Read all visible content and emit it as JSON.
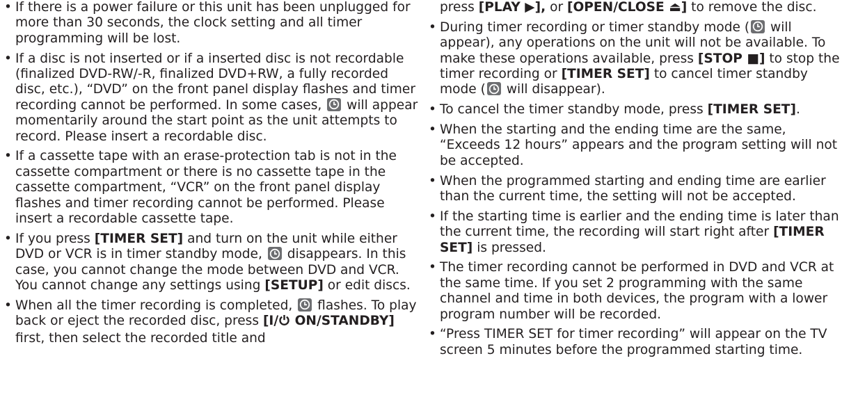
{
  "left_column": [
    {
      "parts": [
        {
          "t": "If there is a power failure or this unit has been unplugged for more than 30 seconds, the clock setting and all timer programming will be lost."
        }
      ]
    },
    {
      "parts": [
        {
          "t": "If a disc is not inserted or if a inserted disc is not recordable (finalized DVD-RW/-R, finalized DVD+RW, a fully recorded disc, etc.), “DVD” on the front panel display flashes and timer recording cannot be performed. In some cases, "
        },
        {
          "icon": "timer-icon"
        },
        {
          "t": " will appear momentarily around the start point as the unit attempts to record. Please insert a recordable disc."
        }
      ]
    },
    {
      "parts": [
        {
          "t": "If a cassette tape with an erase-protection tab is not in the cassette compartment or there is no cassette tape in the cassette compartment, “VCR” on the front panel display flashes and timer recording cannot be performed. Please insert a recordable cassette tape."
        }
      ]
    },
    {
      "parts": [
        {
          "t": "If you press "
        },
        {
          "b": "[TIMER SET]"
        },
        {
          "t": " and turn on the unit while either DVD or VCR is in timer standby mode, "
        },
        {
          "icon": "timer-icon"
        },
        {
          "t": " disappears. In this case, you cannot change the mode between DVD and VCR. You cannot change any settings using "
        },
        {
          "b": "[SETUP]"
        },
        {
          "t": " or edit discs."
        }
      ]
    },
    {
      "parts": [
        {
          "t": "When all the timer recording is completed, "
        },
        {
          "icon": "timer-icon"
        },
        {
          "t": " flashes. To play back or eject the recorded disc, press "
        },
        {
          "b": "[I/"
        },
        {
          "icon": "power-icon"
        },
        {
          "b": " ON/STANDBY]"
        },
        {
          "t": " first, then select the recorded title and"
        }
      ]
    }
  ],
  "right_column_continuation": [
    {
      "t": "press "
    },
    {
      "b": "[PLAY ▶],"
    },
    {
      "t": " or "
    },
    {
      "b": "[OPEN/CLOSE ⏏]"
    },
    {
      "t": " to remove the disc."
    }
  ],
  "right_column": [
    {
      "parts": [
        {
          "t": "During timer recording or timer standby mode ("
        },
        {
          "icon": "timer-icon"
        },
        {
          "t": " will appear), any operations on the unit will not be available. To make these operations available, press "
        },
        {
          "b": "[STOP ■]"
        },
        {
          "t": " to stop the timer recording or "
        },
        {
          "b": "[TIMER SET]"
        },
        {
          "t": " to cancel timer standby mode ("
        },
        {
          "icon": "timer-icon"
        },
        {
          "t": " will disappear)."
        }
      ]
    },
    {
      "parts": [
        {
          "t": "To cancel the timer standby mode, press "
        },
        {
          "b": "[TIMER SET]"
        },
        {
          "t": "."
        }
      ]
    },
    {
      "parts": [
        {
          "t": "When the starting and the ending time are the same, “Exceeds 12 hours” appears and the program setting will not be accepted."
        }
      ]
    },
    {
      "parts": [
        {
          "t": "When the programmed starting and ending time are earlier than the current time, the setting will not be accepted."
        }
      ]
    },
    {
      "parts": [
        {
          "t": "If the starting time is earlier and the ending time is later than the current time, the recording will start right after "
        },
        {
          "b": "[TIMER SET]"
        },
        {
          "t": " is pressed."
        }
      ]
    },
    {
      "parts": [
        {
          "t": "The timer recording cannot be performed in DVD and VCR at the same time. If you set 2 programming with the same channel and time in both devices, the program with a lower program number will be recorded."
        }
      ]
    },
    {
      "parts": [
        {
          "t": "“Press TIMER SET for timer recording” will appear on the TV screen 5 minutes before the programmed starting time."
        }
      ]
    }
  ]
}
